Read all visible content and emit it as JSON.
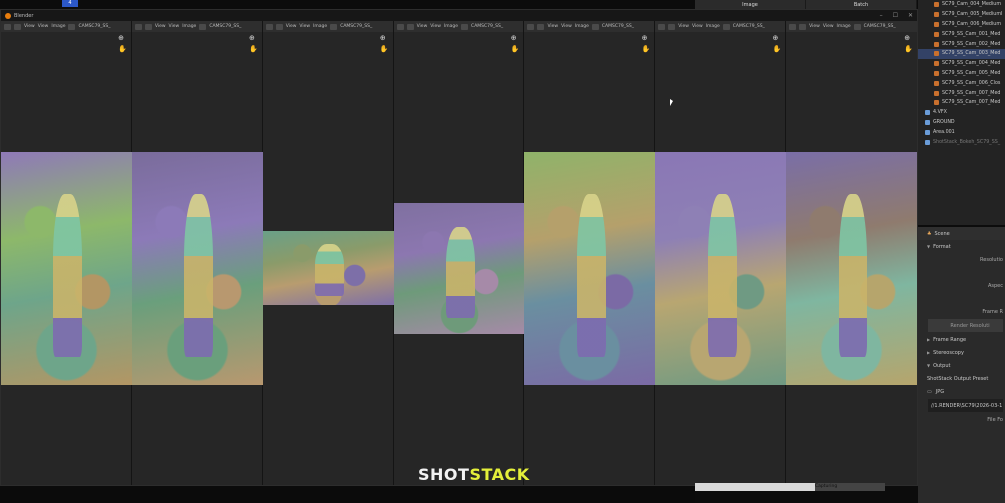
{
  "top_tab": {
    "label": "4"
  },
  "window": {
    "title": "Blender",
    "controls": [
      "–",
      "☐",
      "✕"
    ]
  },
  "viewport_menu": {
    "view": "View",
    "image": "Image"
  },
  "panes": [
    {
      "camera": "CAMSC79_SS_",
      "colors": [
        "#8db86a",
        "#6ea58a",
        "#b39664",
        "#8f79b8"
      ]
    },
    {
      "camera": "CAMSC79_SS_",
      "colors": [
        "#8c7ab8",
        "#6a9f7c",
        "#b8986f",
        "#7a6c9b"
      ]
    },
    {
      "camera": "CAMSC79_SS_",
      "colors": [
        "#8a9b6a",
        "#b89c6f",
        "#7d6fa8",
        "#6aa088"
      ]
    },
    {
      "camera": "CAMSC79_SS_",
      "colors": [
        "#8c77b0",
        "#6e9a7a",
        "#a68aa8",
        "#7f70a0"
      ]
    },
    {
      "camera": "CAMSC79_SS_",
      "colors": [
        "#b5a06b",
        "#6a8fa0",
        "#7b6aa5",
        "#8fb36a"
      ]
    },
    {
      "camera": "CAMSC79_SS_",
      "colors": [
        "#8e80b5",
        "#b8a671",
        "#6f9a83",
        "#8a77b5"
      ]
    },
    {
      "camera": "CAMSC79_SS_",
      "colors": [
        "#8f7b6e",
        "#7fb6a0",
        "#b6a56c",
        "#7a6ea7"
      ]
    }
  ],
  "topbar": {
    "image": "Image",
    "batch": "Batch"
  },
  "outliner": {
    "rows": [
      {
        "label": "SC79_Cam_004_Medium",
        "level": 1,
        "selected": false
      },
      {
        "label": "SC79_Cam_005_MediumI",
        "level": 1,
        "selected": false
      },
      {
        "label": "SC79_Cam_006_Medium",
        "level": 1,
        "selected": false
      },
      {
        "label": "SC79_SS_Cam_001_Med",
        "level": 1,
        "selected": false
      },
      {
        "label": "SC79_SS_Cam_002_Med",
        "level": 1,
        "selected": false
      },
      {
        "label": "SC79_SS_Cam_003_Med",
        "level": 1,
        "selected": true
      },
      {
        "label": "SC79_SS_Cam_004_Med",
        "level": 1,
        "selected": false
      },
      {
        "label": "SC79_SS_Cam_005_Med",
        "level": 1,
        "selected": false
      },
      {
        "label": "SC79_SS_Cam_006_Clos",
        "level": 1,
        "selected": false
      },
      {
        "label": "SC79_SS_Cam_007_Med",
        "level": 1,
        "selected": false
      },
      {
        "label": "SC79_SS_Cam_007_Med",
        "level": 1,
        "selected": false
      },
      {
        "label": "4.VFX",
        "level": 0,
        "selected": false
      },
      {
        "label": "GROUND",
        "level": 0,
        "selected": false
      },
      {
        "label": "Area.001",
        "level": 0,
        "selected": false
      },
      {
        "label": "ShotStack_Bokeh_SC79_SS_",
        "level": 0,
        "selected": false,
        "dim": true
      }
    ]
  },
  "properties": {
    "scene": "Scene",
    "format": "Format",
    "resolution": "Resolutio",
    "aspect": "Aspec",
    "frame_rate": "Frame R",
    "render_resolution": "Render Resoluti",
    "frame_range": "Frame Range",
    "stereoscopy": "Stereoscopy",
    "output": "Output",
    "output_preset": "ShotStack Output Preset",
    "file_format": "JPG",
    "path": "//1.RENDER\\SC79\\2026-03-1",
    "file_fo": "File Fo"
  },
  "progress": {
    "value": 0.63,
    "label": "Capturing"
  },
  "watermark": {
    "part1": "SHOT",
    "part2": "STACK"
  }
}
